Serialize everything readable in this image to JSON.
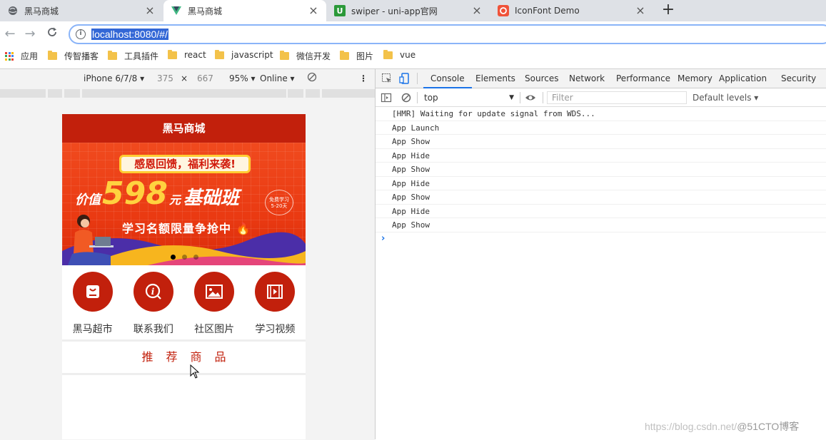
{
  "browser": {
    "tabs": [
      {
        "title": "黑马商城",
        "active": false
      },
      {
        "title": "黑马商城",
        "active": true
      },
      {
        "title": "swiper - uni-app官网",
        "active": false
      },
      {
        "title": "IconFont Demo",
        "active": false
      }
    ],
    "new_tab_label": "+",
    "url": "localhost:8080/#/",
    "bookmarks": [
      "应用",
      "传智播客",
      "工具插件",
      "react",
      "javascript",
      "微信开发",
      "图片",
      "vue"
    ]
  },
  "device_toolbar": {
    "device": "iPhone 6/7/8",
    "width": "375",
    "times": "×",
    "height": "667",
    "zoom": "95%",
    "network": "Online"
  },
  "app": {
    "title": "黑马商城",
    "banner": {
      "headline": "感恩回馈，福利来袭!",
      "price_prefix": "价值",
      "price": "598",
      "price_unit": "元",
      "course": "基础班",
      "badge_line1": "免费学习",
      "badge_line2": "5-20天",
      "slogan": "学习名额限量争抢中"
    },
    "swiper_dots": {
      "count": 3,
      "active": 0
    },
    "navs": [
      {
        "label": "黑马超市",
        "icon": "shop-icon"
      },
      {
        "label": "联系我们",
        "icon": "info-icon"
      },
      {
        "label": "社区图片",
        "icon": "picture-icon"
      },
      {
        "label": "学习视频",
        "icon": "video-icon"
      }
    ],
    "hot_title": "推荐商品"
  },
  "devtools": {
    "tabs": [
      "Console",
      "Elements",
      "Sources",
      "Network",
      "Performance",
      "Memory",
      "Application",
      "Security"
    ],
    "active_tab": "Console",
    "context": "top",
    "filter_placeholder": "Filter",
    "levels": "Default levels ▾",
    "logs": [
      "[HMR] Waiting for update signal from WDS...",
      "App Launch",
      "App Show",
      "App Hide",
      "App Show",
      "App Hide",
      "App Show",
      "App Hide",
      "App Show"
    ],
    "prompt": "›"
  },
  "watermark": {
    "text": "https://blog.csdn.net/",
    "brand": "@51CTO博客"
  },
  "colors": {
    "brand": "#c2200c",
    "accent": "#1a73e8"
  }
}
